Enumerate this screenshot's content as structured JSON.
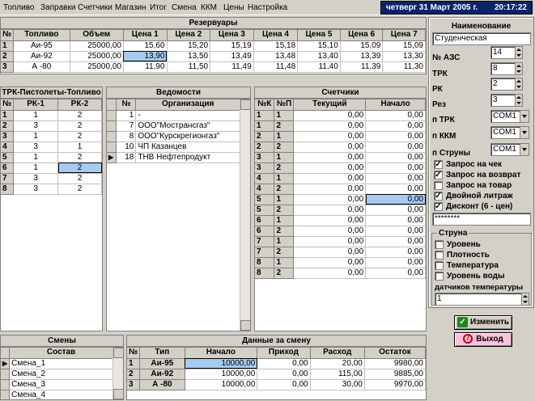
{
  "menu": [
    "Топливо",
    "Заправки",
    "Счетчики",
    "Магазин",
    "Итог",
    "Смена",
    "ККМ",
    "Цены",
    "Настройка"
  ],
  "status": {
    "date": "четверг 31 Март 2005 г.",
    "time": "20:17:22"
  },
  "reservoirs": {
    "title": "Резервуары",
    "headers": [
      "№",
      "Топливо",
      "Объем",
      "Цена 1",
      "Цена 2",
      "Цена 3",
      "Цена 4",
      "Цена 5",
      "Цена 6",
      "Цена 7"
    ],
    "rows": [
      [
        "1",
        "Аи-95",
        "25000,00",
        "15,60",
        "15,20",
        "15,19",
        "15,18",
        "15,10",
        "15,09",
        "15,09"
      ],
      [
        "2",
        "Аи-92",
        "25000,00",
        "13,90",
        "13,50",
        "13,49",
        "13,48",
        "13,40",
        "13,39",
        "13,30"
      ],
      [
        "3",
        "А -80",
        "25000,00",
        "11,90",
        "11,50",
        "11,49",
        "11,48",
        "11,40",
        "11,39",
        "11,30"
      ]
    ]
  },
  "pistols": {
    "title": "ТРК-Пистолеты-Топливо",
    "headers": [
      "№",
      "РК-1",
      "РК-2"
    ],
    "rows": [
      [
        "1",
        "1",
        "2"
      ],
      [
        "2",
        "3",
        "2"
      ],
      [
        "3",
        "1",
        "2"
      ],
      [
        "4",
        "3",
        "1"
      ],
      [
        "5",
        "1",
        "2"
      ],
      [
        "6",
        "1",
        "2"
      ],
      [
        "7",
        "3",
        "2"
      ],
      [
        "8",
        "3",
        "2"
      ]
    ]
  },
  "statements": {
    "title": "Ведомости",
    "headers": [
      "№",
      "Организация"
    ],
    "rows": [
      [
        "1",
        "-"
      ],
      [
        "7",
        "ООО\"Мострансгаз\""
      ],
      [
        "8",
        "ООО\"Курскрегионгаз\""
      ],
      [
        "10",
        "ЧП Казанцев"
      ],
      [
        "18",
        "ТНВ Нефтепродукт"
      ]
    ]
  },
  "counters": {
    "title": "Счетчики",
    "headers": [
      "№К",
      "№П",
      "Текущий",
      "Начало"
    ],
    "rows": [
      [
        "1",
        "1",
        "0,00",
        "0,00"
      ],
      [
        "1",
        "2",
        "0,00",
        "0,00"
      ],
      [
        "2",
        "1",
        "0,00",
        "0,00"
      ],
      [
        "2",
        "2",
        "0,00",
        "0,00"
      ],
      [
        "3",
        "1",
        "0,00",
        "0,00"
      ],
      [
        "3",
        "2",
        "0,00",
        "0,00"
      ],
      [
        "4",
        "1",
        "0,00",
        "0,00"
      ],
      [
        "4",
        "2",
        "0,00",
        "0,00"
      ],
      [
        "5",
        "1",
        "0,00",
        "0,00"
      ],
      [
        "5",
        "2",
        "0,00",
        "0,00"
      ],
      [
        "6",
        "1",
        "0,00",
        "0,00"
      ],
      [
        "6",
        "2",
        "0,00",
        "0,00"
      ],
      [
        "7",
        "1",
        "0,00",
        "0,00"
      ],
      [
        "7",
        "2",
        "0,00",
        "0,00"
      ],
      [
        "8",
        "1",
        "0,00",
        "0,00"
      ],
      [
        "8",
        "2",
        "0,00",
        "0,00"
      ]
    ]
  },
  "settings": {
    "name_label": "Наименование",
    "name_value": "Студенческая",
    "azs_label": "№ АЗС",
    "azs_value": "14",
    "trk_label": "ТРК",
    "trk_value": "8",
    "rk_label": "РК",
    "rk_value": "2",
    "rez_label": "Рез",
    "rez_value": "3",
    "ptrk_label": "п ТРК",
    "ptrk_value": "COM1",
    "pkkm_label": "п ККМ",
    "pkkm_value": "COM1",
    "pstr_label": "п Струны",
    "pstr_value": "COM1",
    "checks": [
      {
        "label": "Запрос на чек",
        "checked": true
      },
      {
        "label": "Запрос на возврат",
        "checked": true
      },
      {
        "label": "Запрос на товар",
        "checked": false
      },
      {
        "label": "Двойной литраж",
        "checked": true
      },
      {
        "label": "Дисконт (6 - цен)",
        "checked": true
      }
    ],
    "password": "********",
    "string_group": "Струна",
    "string_checks": [
      "Уровень",
      "Плотность",
      "Температура",
      "Уровень воды"
    ],
    "sensors_label": "датчиков  температуры",
    "sensors_value": "1",
    "change_btn": "Изменить",
    "exit_btn": "Выход"
  },
  "shifts": {
    "title": "Смены",
    "header": "Состав",
    "rows": [
      "Смена_1",
      "Смена_2",
      "Смена_3",
      "Смена_4"
    ]
  },
  "shift_data": {
    "title": "Данные за смену",
    "headers": [
      "№",
      "Тип",
      "Начало",
      "Приход",
      "Расход",
      "Остаток"
    ],
    "rows": [
      [
        "1",
        "Аи-95",
        "10000,00",
        "0,00",
        "20,00",
        "9980,00"
      ],
      [
        "2",
        "Аи-92",
        "10000,00",
        "0,00",
        "115,00",
        "9885,00"
      ],
      [
        "3",
        "А -80",
        "10000,00",
        "0,00",
        "30,00",
        "9970,00"
      ]
    ]
  }
}
